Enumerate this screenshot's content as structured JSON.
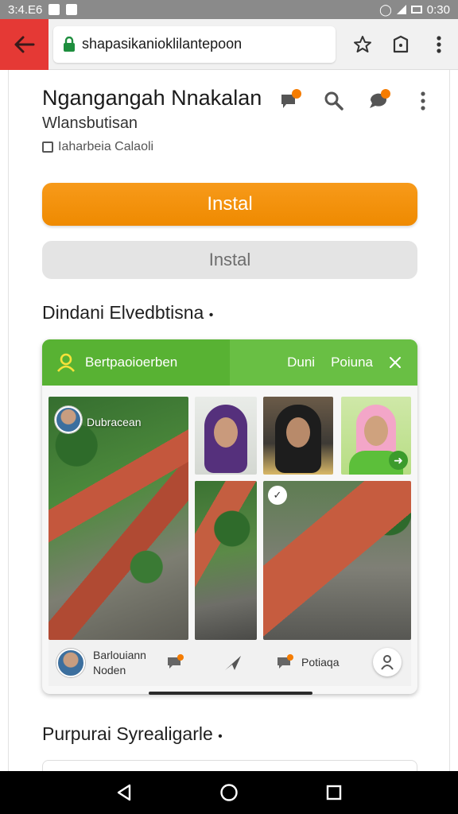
{
  "status_bar": {
    "time_left": "3:4.E6",
    "time_right": "0:30"
  },
  "browser": {
    "url": "shapasikanioklilantepoon"
  },
  "app": {
    "title": "Ngangangah Nnakalan",
    "developer": "Wlansbutisan",
    "category": "Iaharbeia Calaoli"
  },
  "buttons": {
    "primary": "Instal",
    "secondary": "Instal"
  },
  "sections": {
    "first_title": "Dindani Elvedbtisna",
    "second_title": "Purpurai Syrealigarle"
  },
  "card": {
    "header_left": "Bertpaoioerben",
    "header_tab1": "Duni",
    "header_tab2": "Poiuna",
    "tile1_label": "Dubracean",
    "bottom_name_line1": "Barlouiann",
    "bottom_name_line2": "Noden",
    "bottom_right_label": "Potiaqa"
  },
  "colors": {
    "accent_orange": "#f18f06",
    "green_header": "#5fb83a",
    "back_red": "#e53935"
  },
  "icons": [
    "back-arrow-icon",
    "lock-icon",
    "star-icon",
    "tab-switcher-icon",
    "more-vert-icon",
    "chat-icon",
    "search-icon",
    "comment-icon",
    "user-icon",
    "close-icon",
    "nav-back-icon",
    "nav-home-icon",
    "nav-recents-icon"
  ]
}
